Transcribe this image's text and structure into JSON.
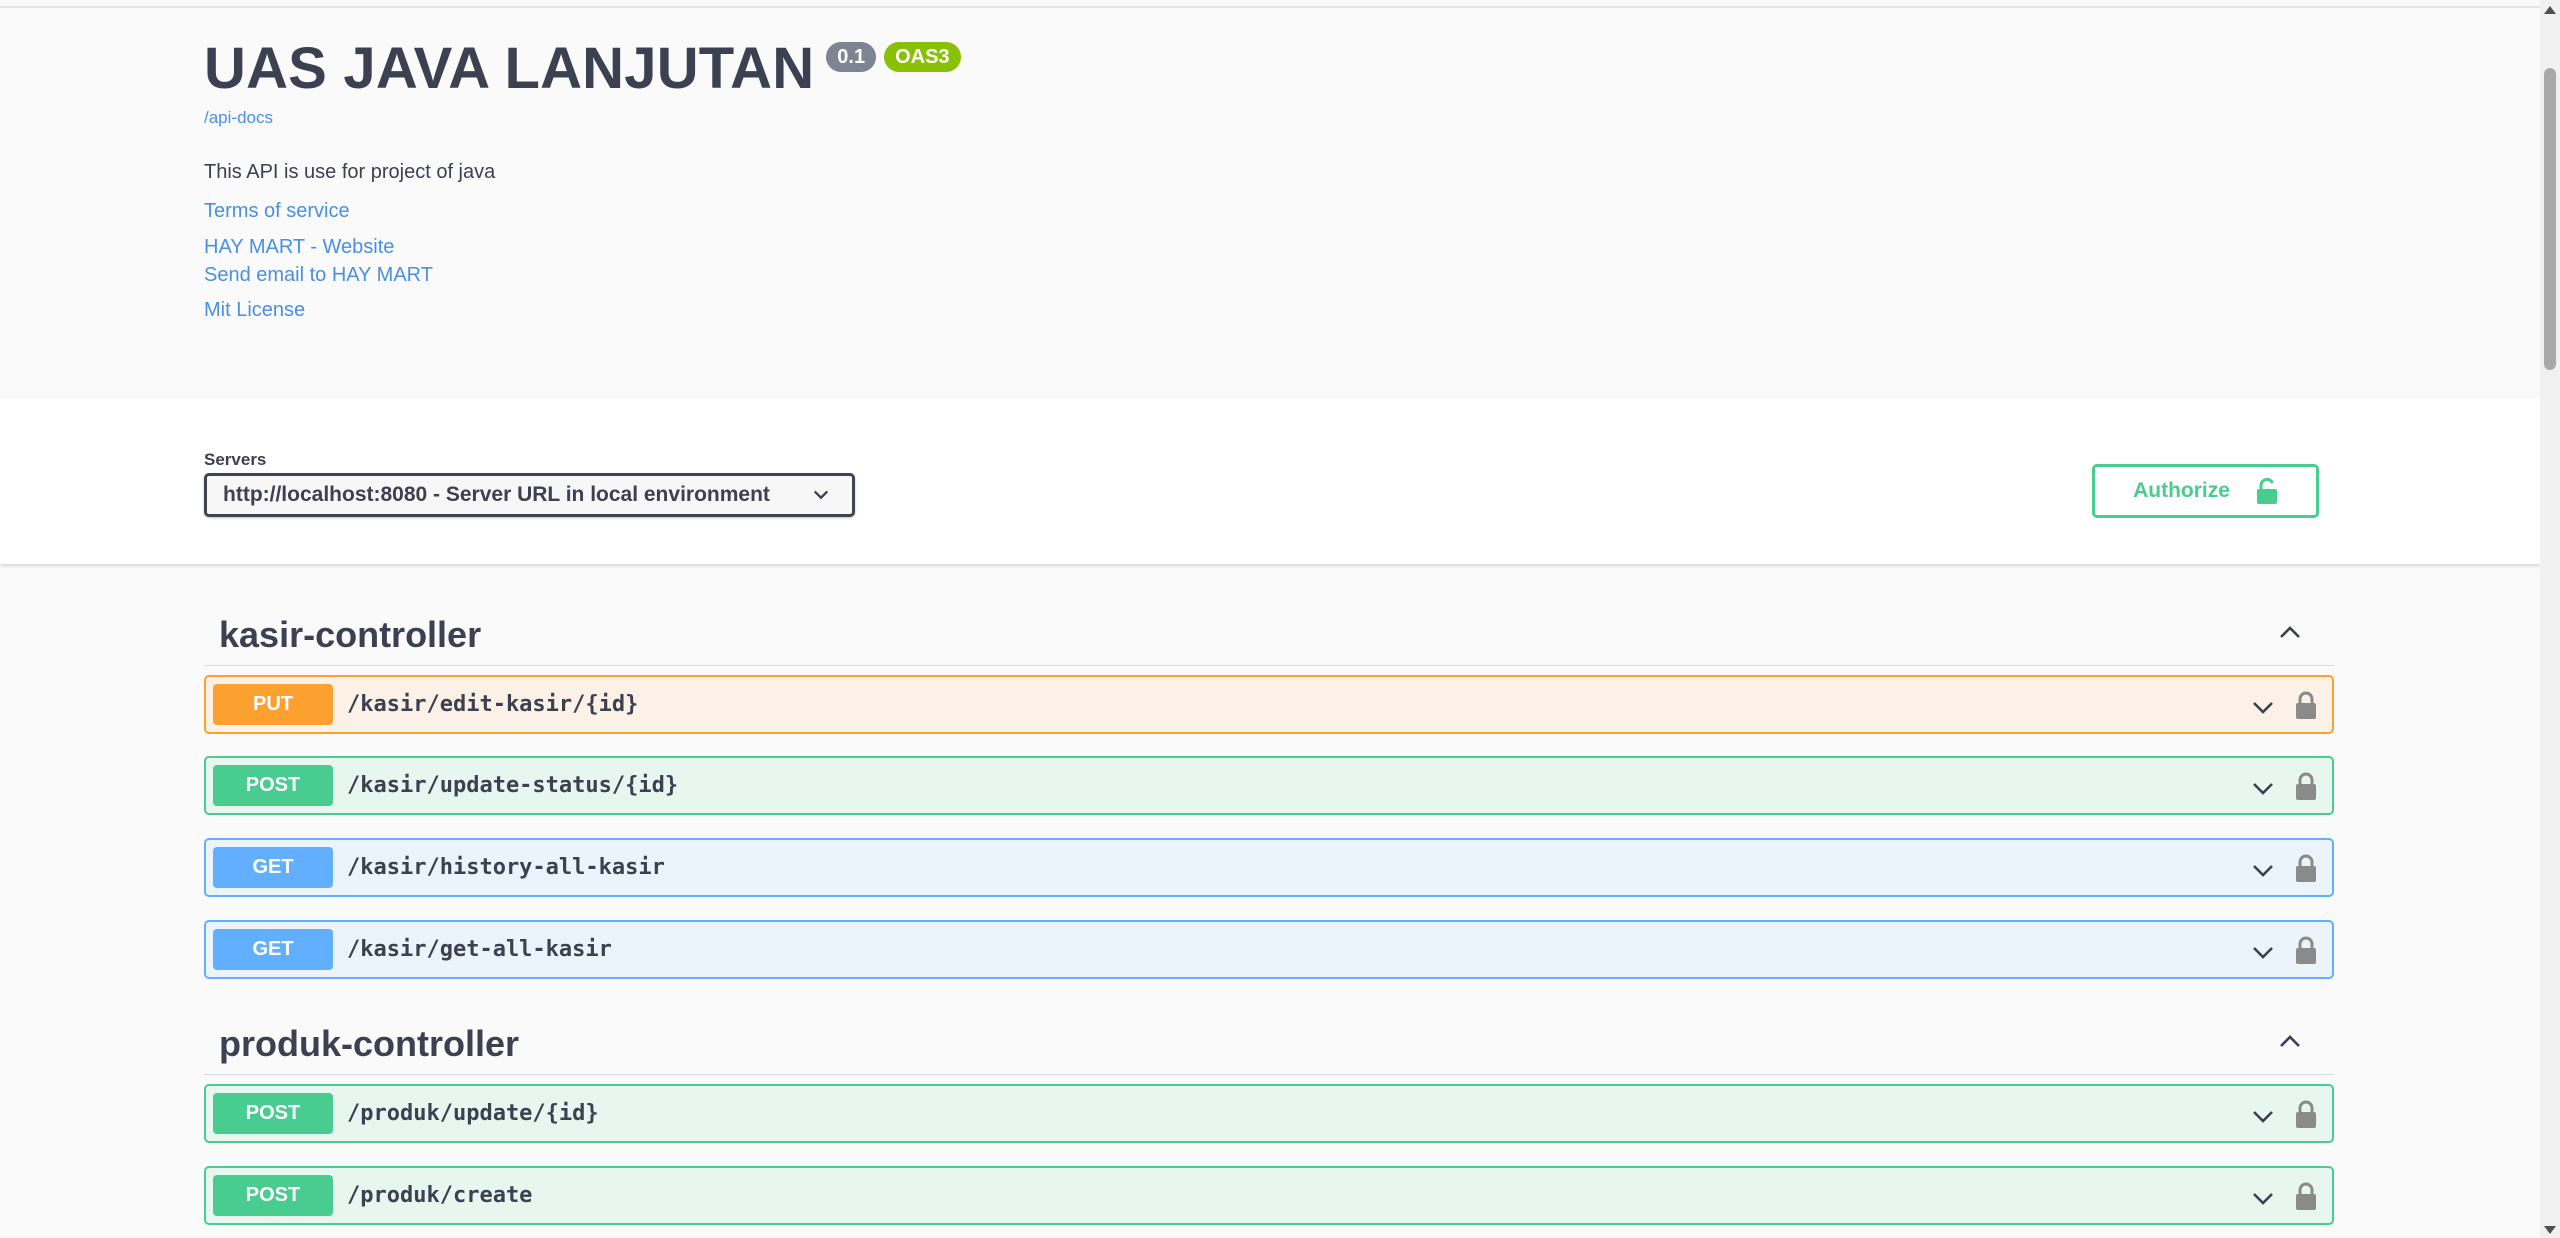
{
  "info": {
    "title": "UAS JAVA LANJUTAN",
    "version": "0.1",
    "oas": "OAS3",
    "api_docs": "/api-docs",
    "description": "This API is use for project of java",
    "links": {
      "terms": "Terms of service",
      "website": "HAY MART - Website",
      "email": "Send email to HAY MART",
      "license": "Mit License"
    }
  },
  "servers": {
    "label": "Servers",
    "selected": "http://localhost:8080 - Server URL in local environment",
    "authorize_label": "Authorize"
  },
  "groups": [
    {
      "name": "kasir-controller",
      "operations": [
        {
          "method": "PUT",
          "path": "/kasir/edit-kasir/{id}"
        },
        {
          "method": "POST",
          "path": "/kasir/update-status/{id}"
        },
        {
          "method": "GET",
          "path": "/kasir/history-all-kasir"
        },
        {
          "method": "GET",
          "path": "/kasir/get-all-kasir"
        }
      ]
    },
    {
      "name": "produk-controller",
      "operations": [
        {
          "method": "POST",
          "path": "/produk/update/{id}"
        },
        {
          "method": "POST",
          "path": "/produk/create"
        }
      ]
    }
  ],
  "colors": {
    "put": "#fca130",
    "post": "#49cc90",
    "get": "#61afe",
    "link": "#4990e2",
    "text": "#3b4151"
  }
}
